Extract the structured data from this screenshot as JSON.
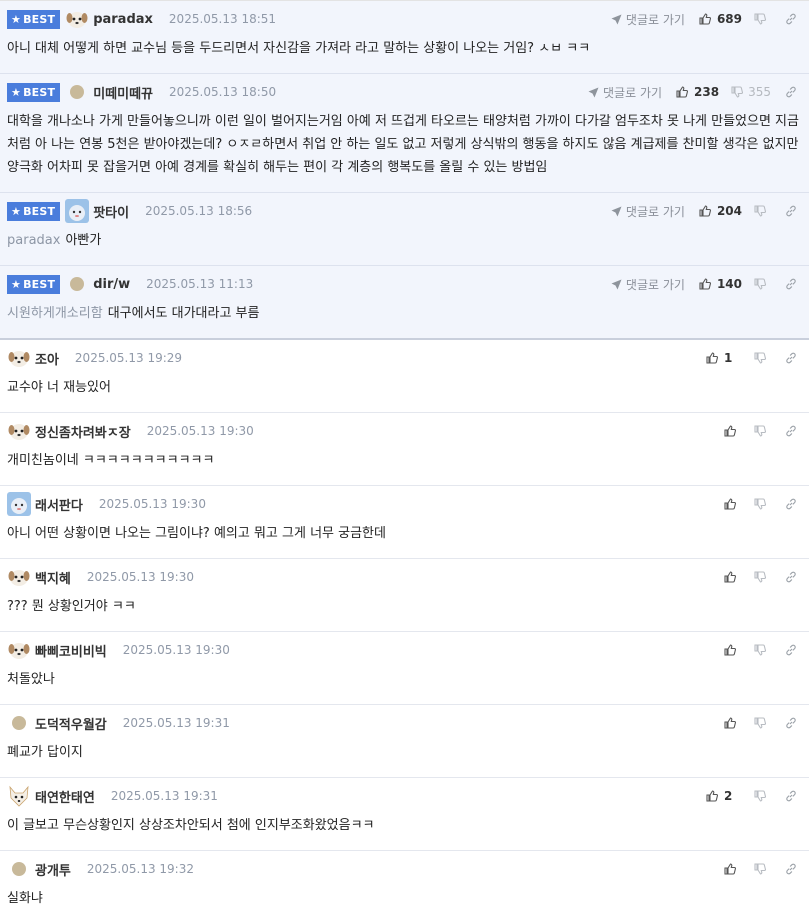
{
  "best_badge": "BEST",
  "reply_label": "댓글로 가기",
  "colors": {
    "badge": "#4a7ddc",
    "best_bg": "#f2f5fc"
  },
  "comments": [
    {
      "best": true,
      "nick": "paradax",
      "date": "2025.05.13 18:51",
      "reply_link": true,
      "likes": "689",
      "dislikes": "",
      "mention": "",
      "text": "아니 대체 어떻게 하면 교수님 등을 두드리면서 자신감을 가져라 라고 말하는 상황이 나오는 거임? ㅅㅂ ㅋㅋ",
      "avatar": "dog"
    },
    {
      "best": true,
      "nick": "미떼미떼뀨",
      "date": "2025.05.13 18:50",
      "reply_link": true,
      "likes": "238",
      "dislikes": "355",
      "mention": "",
      "text": "대학을 개나소나 가게 만들어놓으니까 이런 일이 벌어지는거임 아예 저 뜨겁게 타오르는 태양처럼 가까이 다가갈 엄두조차 못 나게 만들었으면 지금처럼 아 나는 연봉 5천은 받아야겠는데? ㅇㅈㄹ하면서 취업 안 하는 일도 없고 저렇게 상식밖의 행동을 하지도 않음 계급제를 찬미할 생각은 없지만 양극화 어차피 못 잡을거면 아예 경계를 확실히 해두는 편이 각 계층의 행복도를 올릴 수 있는 방법임",
      "avatar": "dot"
    },
    {
      "best": true,
      "nick": "팟타이",
      "date": "2025.05.13 18:56",
      "reply_link": true,
      "likes": "204",
      "dislikes": "",
      "mention": "paradax",
      "text": "아빤가",
      "avatar": "blue"
    },
    {
      "best": true,
      "nick": "dir/w",
      "date": "2025.05.13 11:13",
      "reply_link": true,
      "likes": "140",
      "dislikes": "",
      "mention": "시원하게개소리함",
      "text": "대구에서도 대가대라고 부름",
      "avatar": "dot"
    },
    {
      "best": false,
      "nick": "조아",
      "date": "2025.05.13 19:29",
      "reply_link": false,
      "likes": "1",
      "dislikes": "",
      "mention": "",
      "text": "교수야 너 재능있어",
      "avatar": "dog"
    },
    {
      "best": false,
      "nick": "정신좀차려봐ㅈ장",
      "date": "2025.05.13 19:30",
      "reply_link": false,
      "likes": "",
      "dislikes": "",
      "mention": "",
      "text": "개미친놈이네 ㅋㅋㅋㅋㅋㅋㅋㅋㅋㅋㅋ",
      "avatar": "dog"
    },
    {
      "best": false,
      "nick": "래서판다",
      "date": "2025.05.13 19:30",
      "reply_link": false,
      "likes": "",
      "dislikes": "",
      "mention": "",
      "text": "아니 어떤 상황이면 나오는 그림이냐? 예의고 뭐고 그게 너무 궁금한데",
      "avatar": "blue"
    },
    {
      "best": false,
      "nick": "백지혜",
      "date": "2025.05.13 19:30",
      "reply_link": false,
      "likes": "",
      "dislikes": "",
      "mention": "",
      "text": "??? 뭔 상황인거야 ㅋㅋ",
      "avatar": "dog"
    },
    {
      "best": false,
      "nick": "빠삐코비비빅",
      "date": "2025.05.13 19:30",
      "reply_link": false,
      "likes": "",
      "dislikes": "",
      "mention": "",
      "text": "처돌았나",
      "avatar": "dog"
    },
    {
      "best": false,
      "nick": "도덕적우월감",
      "date": "2025.05.13 19:31",
      "reply_link": false,
      "likes": "",
      "dislikes": "",
      "mention": "",
      "text": "폐교가 답이지",
      "avatar": "dot"
    },
    {
      "best": false,
      "nick": "태연한태연",
      "date": "2025.05.13 19:31",
      "reply_link": false,
      "likes": "2",
      "dislikes": "",
      "mention": "",
      "text": "이 글보고 무슨상황인지 상상조차안되서 첨에 인지부조화왔었음ㅋㅋ",
      "avatar": "fox"
    },
    {
      "best": false,
      "nick": "광개투",
      "date": "2025.05.13 19:32",
      "reply_link": false,
      "likes": "",
      "dislikes": "",
      "mention": "",
      "text": "실화냐",
      "avatar": "dot"
    }
  ]
}
